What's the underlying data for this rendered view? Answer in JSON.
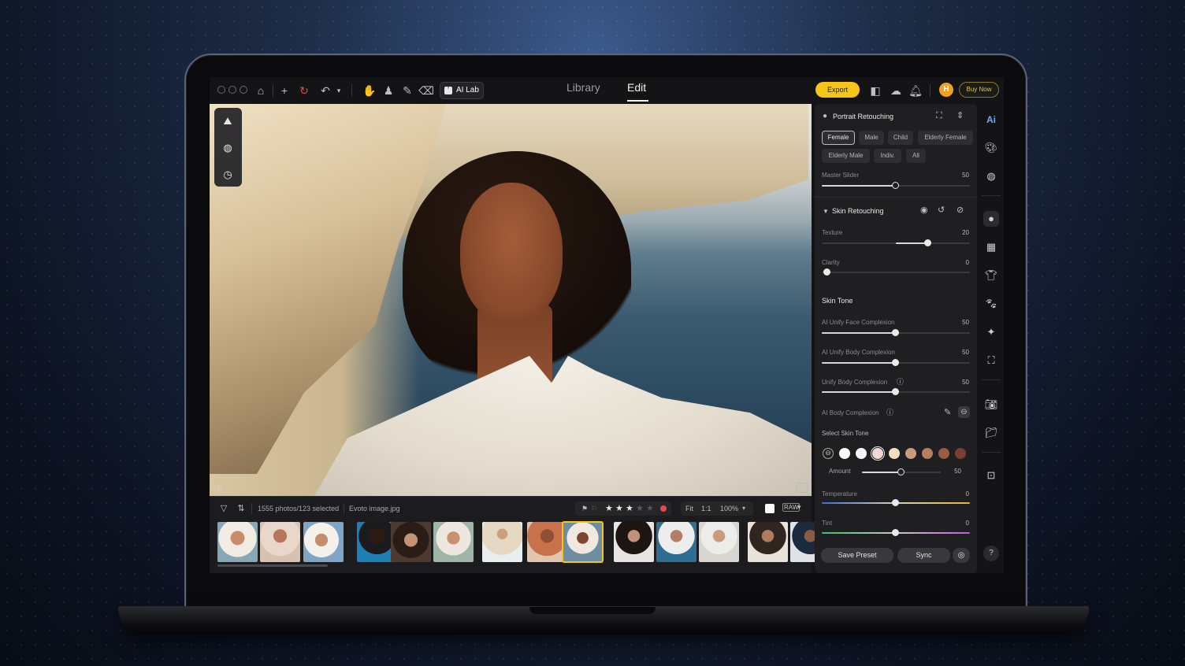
{
  "topbar": {
    "tabs": [
      {
        "label": "Library"
      },
      {
        "label": "Edit"
      }
    ],
    "ai_lab": "AI Lab",
    "export": "Export",
    "avatar_initial": "H",
    "buy_now": "Buy Now"
  },
  "filmstrip": {
    "count_text": "1555 photos/123 selected",
    "filename": "Evoto image.jpg",
    "fit": "Fit",
    "ratio": "1:1",
    "zoom": "100%",
    "rating": 3,
    "raw_badge": "RAW",
    "thumb_badges": [
      "",
      "",
      "",
      "",
      "",
      "",
      "",
      "",
      "",
      "",
      "",
      "",
      "",
      "",
      ""
    ]
  },
  "panel": {
    "portrait": {
      "title": "Portrait Retouching",
      "chips": [
        "Female",
        "Male",
        "Child",
        "Elderly Female",
        "Elderly Male",
        "Indiv.",
        "All"
      ],
      "master_label": "Master Slider",
      "master_value": "50",
      "master_pct": 50
    },
    "skin": {
      "title": "Skin Retouching",
      "texture_label": "Texture",
      "texture_value": "20",
      "texture_pct": 60,
      "clarity_label": "Clarity",
      "clarity_value": "0",
      "clarity_pct": 0
    },
    "tone": {
      "title": "Skin Tone",
      "face_label": "AI Unify Face Complexion",
      "face_value": "50",
      "body_label": "AI Unify Body Complexion",
      "body_value": "50",
      "unify_label": "Unify Body Complexion",
      "unify_value": "50",
      "ai_body_label": "AI Body Complexion",
      "select_label": "Select Skin Tone",
      "amount_label": "Amount",
      "amount_value": "50",
      "amount_pct": 50,
      "swatches": [
        "#ffffff",
        "#f2f6fb",
        "#f0d9d5",
        "#f3dcc2",
        "#c79a7c",
        "#b97e5f",
        "#9b5c46",
        "#7a3f33"
      ]
    },
    "temperature_label": "Temperature",
    "temperature_value": "0",
    "tint_label": "Tint",
    "tint_value": "0",
    "save_preset": "Save Preset",
    "sync": "Sync"
  },
  "colors": {
    "accent": "#f5c519",
    "panel": "#1f1f22"
  }
}
